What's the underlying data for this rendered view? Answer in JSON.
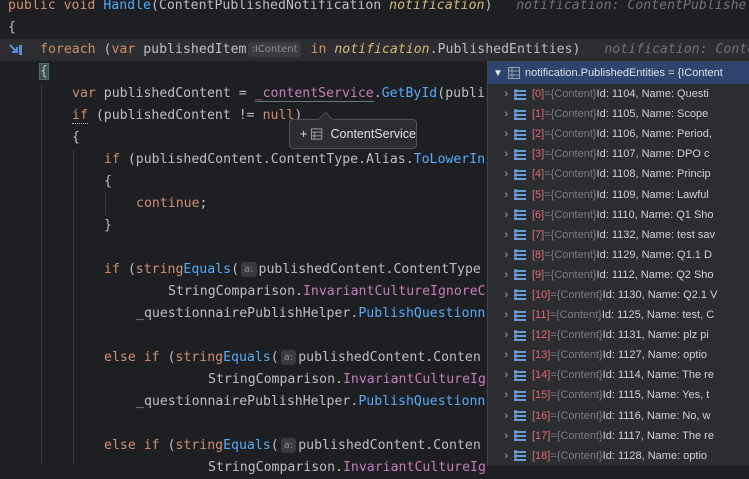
{
  "code": {
    "line1": {
      "kw1": "public",
      "kw2": "void",
      "method": "Handle",
      "open": "(",
      "ptype": "ContentPublishedNotification",
      "pname": "notification",
      "close": ")",
      "hint": "notification: ContentPublishe"
    },
    "line2": "{",
    "line3": {
      "kw": "foreach",
      "p1": " (",
      "kw2": "var",
      "var": " publishedItem",
      "inlay": ":IContent",
      "in": "in",
      "obj": "notification",
      "prop": ".PublishedEntities)",
      "hint": "notification: Conten"
    },
    "line4": "{",
    "line5": {
      "kw": "var",
      "rest": " publishedContent = ",
      "field": "_contentService",
      "dot": ".",
      "method": "GetById",
      "tail": "(publi"
    },
    "line6": {
      "kw": "if",
      "rest": " (publishedContent != ",
      "null": "null",
      ")": ")"
    },
    "line7": "{",
    "line8": {
      "kw": "if",
      "rest": " (publishedContent.ContentType.Alias.",
      "method": "ToLowerIn"
    },
    "line9": "{",
    "line10": {
      "kw": "continue",
      "rest": ";"
    },
    "line11": "}",
    "line12": {
      "kw": "if",
      "p": " (",
      "kw2": "string",
      ".": ".",
      "method": "Equals",
      "o": "(",
      "inlay": "a:",
      "rest": "publishedContent.ContentType"
    },
    "line13": {
      "cls": "StringComparison.",
      "fld": "InvariantCultureIgnoreC"
    },
    "line14": {
      "rest": "_questionnairePublishHelper.",
      "method": "PublishQuestionn"
    },
    "line15": {
      "kw": "else if",
      "p": " (",
      "kw2": "string",
      ".": ".",
      "method": "Equals",
      "o": "(",
      "inlay": "a:",
      "rest": "publishedContent.Conten"
    },
    "line16": {
      "cls": "StringComparison.",
      "fld": "InvariantCultureIg"
    },
    "line17": {
      "rest": "_questionnairePublishHelper.",
      "method": "PublishQuestionn"
    },
    "line18": {
      "kw": "else if",
      "p": " (",
      "kw2": "string",
      ".": ".",
      "method": "Equals",
      "o": "(",
      "inlay": "a:",
      "rest": "publishedContent.Conten"
    },
    "line19": {
      "cls": "StringComparison.",
      "fld": "InvariantCultureIg"
    }
  },
  "tooltip": {
    "plus": "+",
    "label": "ContentService"
  },
  "popup": {
    "header": "notification.PublishedEntities = {IContent",
    "items": [
      {
        "index": "[0]",
        "type": "{Content}",
        "value": "Id: 1104, Name: Questi"
      },
      {
        "index": "[1]",
        "type": "{Content}",
        "value": "Id: 1105, Name: Scope"
      },
      {
        "index": "[2]",
        "type": "{Content}",
        "value": "Id: 1106, Name: Period,"
      },
      {
        "index": "[3]",
        "type": "{Content}",
        "value": "Id: 1107, Name: DPO c"
      },
      {
        "index": "[4]",
        "type": "{Content}",
        "value": "Id: 1108, Name: Princip"
      },
      {
        "index": "[5]",
        "type": "{Content}",
        "value": "Id: 1109, Name: Lawful"
      },
      {
        "index": "[6]",
        "type": "{Content}",
        "value": "Id: 1110, Name: Q1 Sho"
      },
      {
        "index": "[7]",
        "type": "{Content}",
        "value": "Id: 1132, Name: test sav"
      },
      {
        "index": "[8]",
        "type": "{Content}",
        "value": "Id: 1129, Name: Q1.1 D"
      },
      {
        "index": "[9]",
        "type": "{Content}",
        "value": "Id: 1112, Name: Q2 Sho"
      },
      {
        "index": "[10]",
        "type": "{Content}",
        "value": "Id: 1130, Name: Q2.1 V"
      },
      {
        "index": "[11]",
        "type": "{Content}",
        "value": "Id: 1125, Name: test, C"
      },
      {
        "index": "[12]",
        "type": "{Content}",
        "value": "Id: 1131, Name: plz pi"
      },
      {
        "index": "[13]",
        "type": "{Content}",
        "value": "Id: 1127, Name: optio"
      },
      {
        "index": "[14]",
        "type": "{Content}",
        "value": "Id: 1114, Name: The re"
      },
      {
        "index": "[15]",
        "type": "{Content}",
        "value": "Id: 1115, Name: Yes, t"
      },
      {
        "index": "[16]",
        "type": "{Content}",
        "value": "Id: 1116, Name: No, w"
      },
      {
        "index": "[17]",
        "type": "{Content}",
        "value": "Id: 1117, Name: The re"
      },
      {
        "index": "[18]",
        "type": "{Content}",
        "value": "Id: 1128, Name: optio"
      }
    ]
  }
}
